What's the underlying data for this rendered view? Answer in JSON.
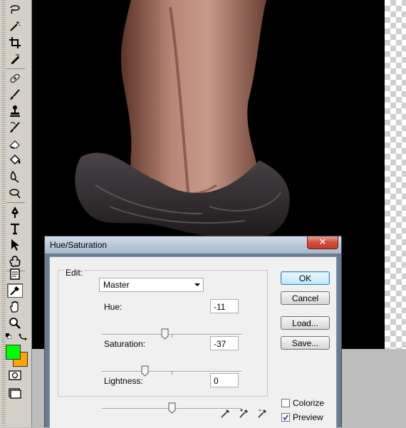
{
  "dialog": {
    "title": "Hue/Saturation",
    "close_glyph": "✕",
    "edit_label": "Edit:",
    "edit_value": "Master",
    "sliders": [
      {
        "label": "Hue:",
        "value": "-11",
        "level_fraction": 0.45
      },
      {
        "label": "Saturation:",
        "value": "-37",
        "level_fraction": 0.31
      },
      {
        "label": "Lightness:",
        "value": "0",
        "level_fraction": 0.5
      }
    ],
    "buttons": {
      "ok": "OK",
      "cancel": "Cancel",
      "load": "Load...",
      "save": "Save..."
    },
    "checkboxes": [
      {
        "label": "Colorize",
        "checked": false
      },
      {
        "label": "Preview",
        "checked": true
      }
    ],
    "eyedroppers": [
      "eyedropper-icon",
      "eyedropper-plus-icon",
      "eyedropper-minus-icon"
    ]
  },
  "toolbox": {
    "tools": [
      "lasso-icon",
      "magic-wand-icon",
      "crop-icon",
      "slice-icon",
      "healing-brush-icon",
      "brush-icon",
      "clone-stamp-icon",
      "history-brush-icon",
      "eraser-icon",
      "paint-bucket-icon",
      "blur-icon",
      "dodge-icon",
      "pen-icon",
      "type-icon",
      "path-selection-icon",
      "custom-shape-icon",
      "notes-icon",
      "eyedropper-icon",
      "hand-icon",
      "zoom-icon",
      "quick-mask-icon",
      "screen-mode-icon"
    ],
    "active_tool": "eyedropper-icon",
    "foreground_color": "#00ff00",
    "background_color": "#ffa500"
  }
}
